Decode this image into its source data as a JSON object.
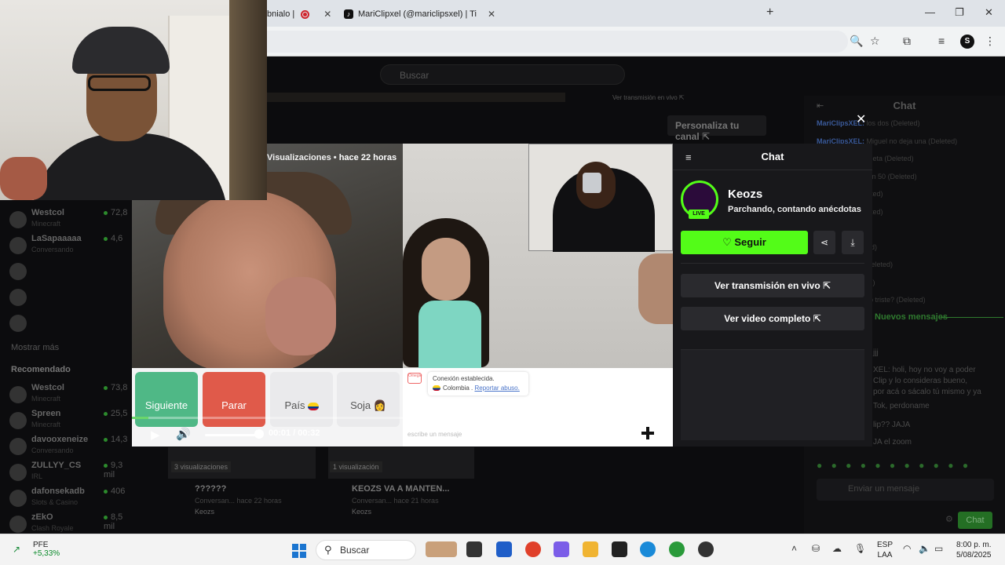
{
  "browser": {
    "tab1_title": "bnialo |",
    "tab2_title": "MariClipxel (@mariclipsxel) | Ti",
    "new_tab_label": "+",
    "minimize": "—",
    "restore": "❐",
    "close": "✕",
    "profile_initial": "S"
  },
  "page": {
    "search_placeholder": "Buscar",
    "ver_transmision_small": "Ver transmisión en vivo ⇱",
    "personaliza": "Personaliza tu canal ⇱"
  },
  "sidebar": {
    "items_top": [
      {
        "name": "Westcol",
        "category": "Minecraft",
        "count": "72,8"
      },
      {
        "name": "LaSapaaaaa",
        "category": "Conversando",
        "count": "4,6"
      },
      {
        "name": "",
        "category": "",
        "count": ""
      },
      {
        "name": "",
        "category": "",
        "count": ""
      },
      {
        "name": "",
        "category": "",
        "count": ""
      }
    ],
    "show_more": "Mostrar más",
    "recommended_heading": "Recomendado",
    "items_rec": [
      {
        "name": "Westcol",
        "category": "Minecraft",
        "count": "73,8"
      },
      {
        "name": "Spreen",
        "category": "Minecraft",
        "count": "25,5"
      },
      {
        "name": "davooxeneize",
        "category": "Conversando",
        "count": "14,3"
      },
      {
        "name": "ZULLYY_CS",
        "category": "IRL",
        "count": "9,3 mil"
      },
      {
        "name": "dafonsekadb",
        "category": "Slots & Casino",
        "count": "406"
      },
      {
        "name": "zEkO",
        "category": "Clash Royale",
        "count": "8,5 mil"
      }
    ]
  },
  "video": {
    "views_text": "Visualizaciones •",
    "time_ago": "hace 22 horas",
    "buttons": {
      "next": "Siguiente",
      "stop": "Parar",
      "country": "País",
      "soja": "Soja 👩"
    },
    "chatlog": {
      "connected": "Conexión establecida.",
      "country": "Colombia",
      "report": "Reportar abuso.",
      "input_placeholder": "escribe un mensaje",
      "icon_text": "Omegle"
    },
    "progress_fraction": 0.03,
    "time": "00:01 / 00:32"
  },
  "panel": {
    "title": "Chat",
    "streamer_name": "Keozs",
    "live": "LIVE",
    "stream_title": "Parchando, contando anécdotas",
    "follow": "♡ Seguir",
    "share_icon": "⋖",
    "download_icon": "⤓",
    "watch_live": "Ver transmisión en vivo ⇱",
    "watch_full": "Ver video completo ⇱",
    "close": "✕"
  },
  "bgchat": {
    "title": "Chat",
    "lines": [
      {
        "user": "MariClipsXEL:",
        "text": "los dos (Deleted)"
      },
      {
        "user": "MariClipsXEL:",
        "text": "Miguel no deja una (Deleted)"
      },
      {
        "user": "",
        "text": "de keozs bro respeta (Deleted)"
      },
      {
        "user": "",
        "text": "XEL: yo le quitó en 50 (Deleted)"
      },
      {
        "user": "",
        "text": "entras toga (Deleted)"
      },
      {
        "user": "",
        "text": "anse si mis (Deleted)"
      },
      {
        "user": "",
        "text": "😂 (Deleted)"
      },
      {
        "user": "",
        "text": "EL: ya ya (Deleted)"
      },
      {
        "user": "",
        "text": "lo quema (mm (Deleted)"
      },
      {
        "user": "",
        "text": "energías (Deleted)"
      },
      {
        "user": "",
        "text": "XEL: por que esto triste? (Deleted)"
      }
    ],
    "new_messages": "Nuevos mensajes",
    "later_lines": [
      "jjj",
      "XEL: holi, hoy no voy a poder",
      "Clip y lo consideras bueno,",
      "por acá o sácalo tú mismo y ya",
      "Tok, perdoname",
      "lip?? JAJA",
      "JA el zoom"
    ],
    "input_placeholder": "Enviar un mensaje",
    "chat_button": "Chat"
  },
  "cards": {
    "card1_views": "3 visualizaciones",
    "card1_title": "??????",
    "card1_sub": "Conversan...   hace 22 horas",
    "card1_user": "Keozs",
    "card2_views": "1 visualización",
    "card2_title": "KEOZS VA A MANTEN...",
    "card2_sub": "Conversan...   hace 21 horas",
    "card2_user": "Keozs"
  },
  "taskbar": {
    "stock_name": "PFE",
    "stock_change": "+5,33%",
    "search": "Buscar",
    "lang_top": "ESP",
    "lang_bottom": "LAA",
    "time": "8:00 p. m.",
    "date": "5/08/2025"
  },
  "colors": {
    "kick_green": "#53fc18",
    "next_green": "#4fb886",
    "stop_red": "#e05a4a",
    "panel_bg": "#18181b"
  }
}
